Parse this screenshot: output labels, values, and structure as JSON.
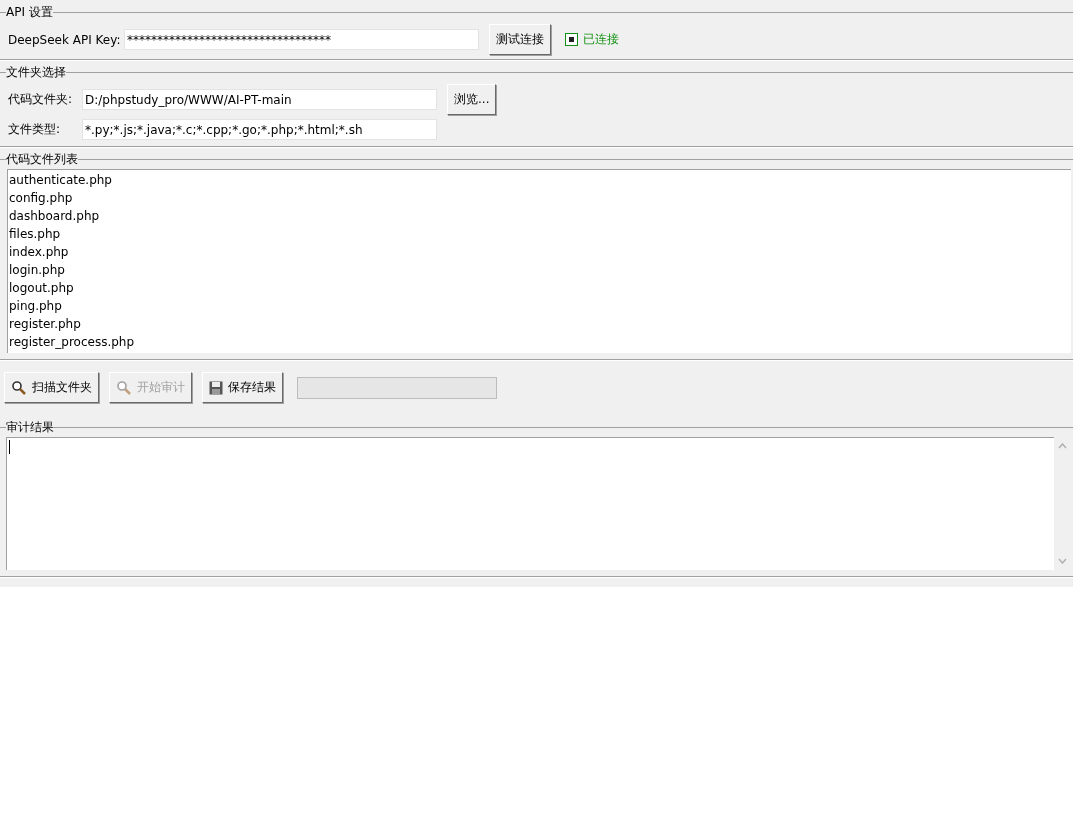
{
  "api_section": {
    "title": "API 设置",
    "key_label": "DeepSeek API Key:",
    "key_value": "**********************************",
    "test_button": "测试连接",
    "status": {
      "label": "已连接",
      "connected": true
    }
  },
  "folder_section": {
    "title": "文件夹选择",
    "folder_label": "代码文件夹:",
    "folder_value": "D:/phpstudy_pro/WWW/AI-PT-main",
    "browse_button": "浏览...",
    "types_label": "文件类型:",
    "types_value": "*.py;*.js;*.java;*.c;*.cpp;*.go;*.php;*.html;*.sh"
  },
  "files_section": {
    "title": "代码文件列表",
    "files": [
      {
        "name": "authenticate.php",
        "selected": false
      },
      {
        "name": "config.php",
        "selected": false
      },
      {
        "name": "dashboard.php",
        "selected": false
      },
      {
        "name": "files.php",
        "selected": false
      },
      {
        "name": "index.php",
        "selected": false
      },
      {
        "name": "login.php",
        "selected": false
      },
      {
        "name": "logout.php",
        "selected": false
      },
      {
        "name": "ping.php",
        "selected": false
      },
      {
        "name": "register.php",
        "selected": false
      },
      {
        "name": "register_process.php",
        "selected": false
      }
    ]
  },
  "toolbar": {
    "buttons": [
      {
        "kind": "scan",
        "label": "扫描文件夹",
        "disabled": false
      },
      {
        "kind": "audit",
        "label": "开始审计",
        "disabled": true
      },
      {
        "kind": "save",
        "label": "保存结果",
        "disabled": false
      }
    ],
    "progress": {
      "level": 0
    }
  },
  "results_section": {
    "title": "审计结果"
  }
}
